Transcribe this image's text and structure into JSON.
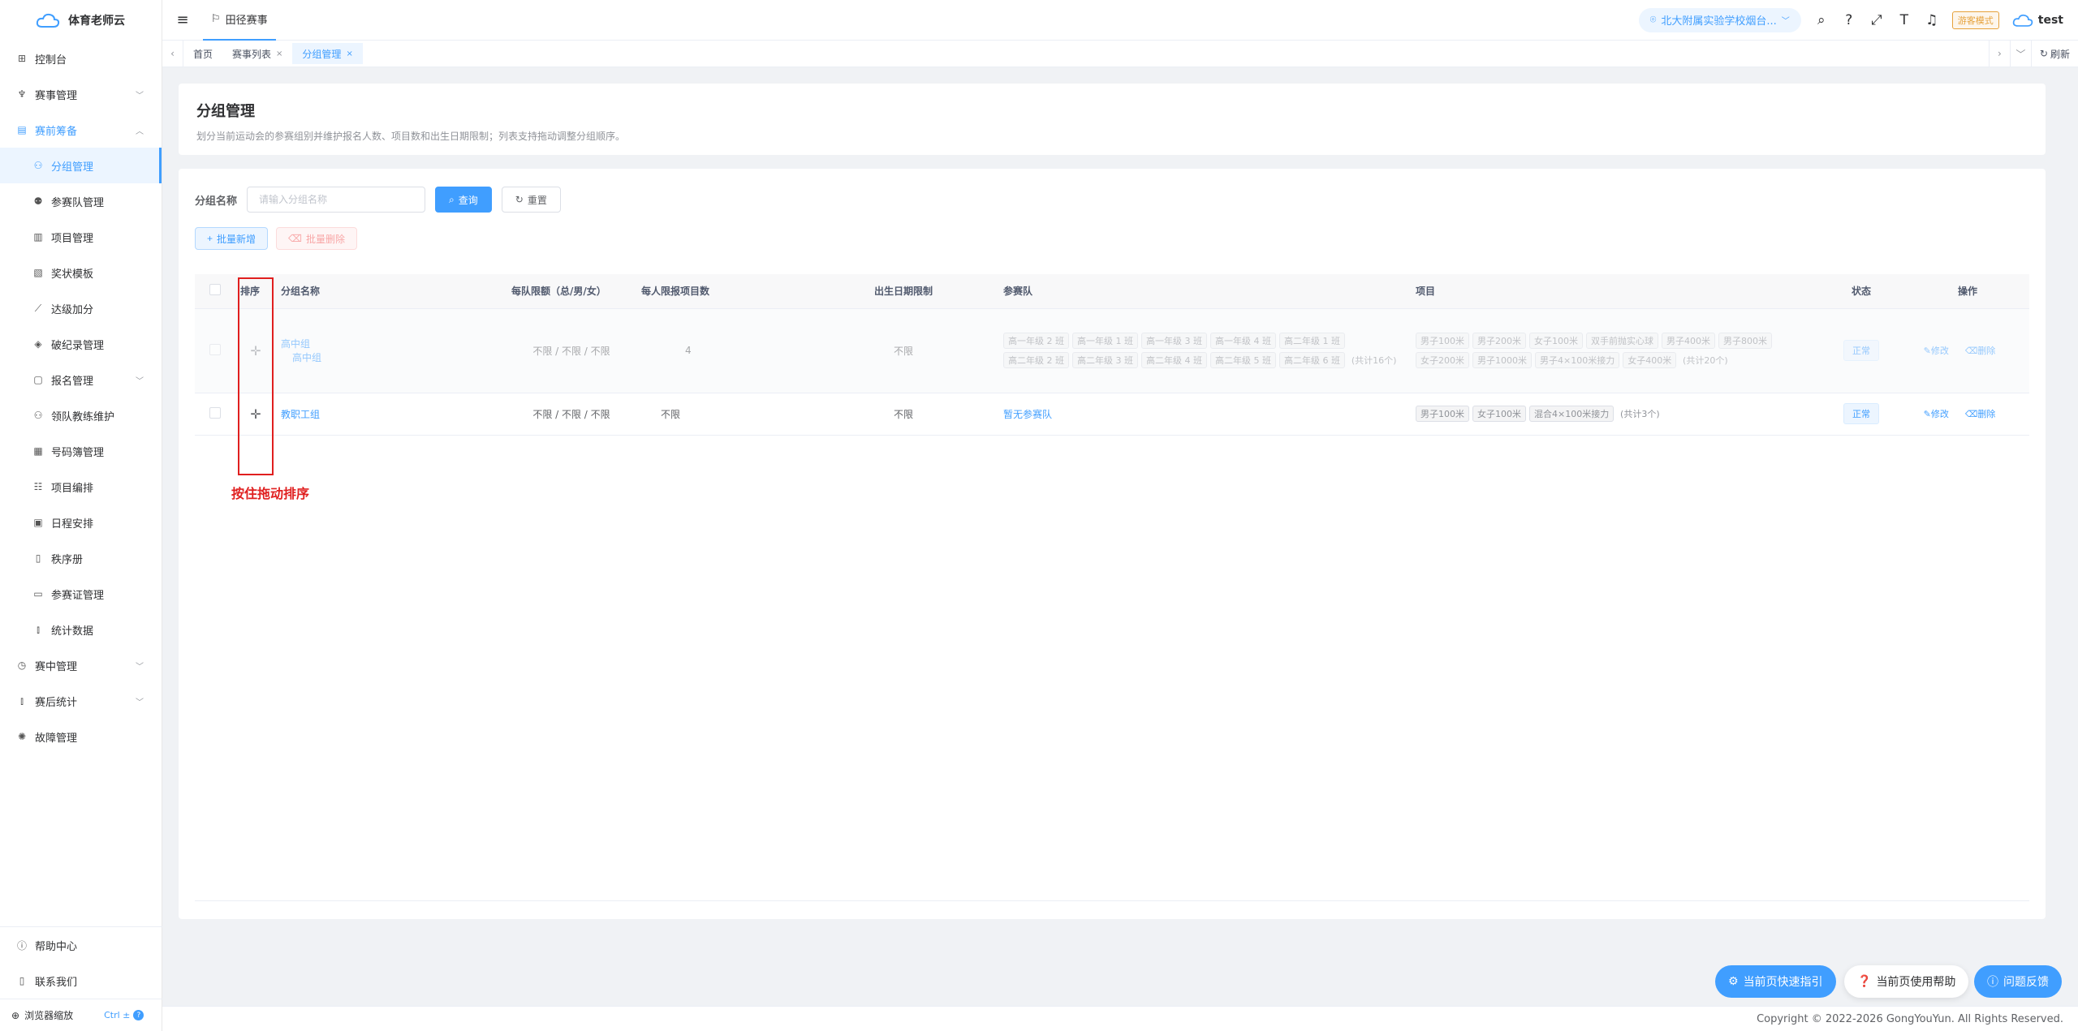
{
  "app": {
    "name": "体育老师云"
  },
  "sidebar": {
    "items": [
      {
        "label": "控制台",
        "icon": "dashboard-icon"
      },
      {
        "label": "赛事管理",
        "icon": "trophy-icon",
        "chevron": "﹀"
      },
      {
        "label": "赛前筹备",
        "icon": "clipboard-icon",
        "chevron": "︿"
      },
      {
        "label": "分组管理",
        "icon": "group-icon"
      },
      {
        "label": "参赛队管理",
        "icon": "team-icon"
      },
      {
        "label": "项目管理",
        "icon": "document-icon"
      },
      {
        "label": "奖状模板",
        "icon": "certificate-icon"
      },
      {
        "label": "达级加分",
        "icon": "chart-icon"
      },
      {
        "label": "破纪录管理",
        "icon": "record-icon"
      },
      {
        "label": "报名管理",
        "icon": "signup-icon",
        "chevron": "﹀"
      },
      {
        "label": "领队教练维护",
        "icon": "coach-icon"
      },
      {
        "label": "号码簿管理",
        "icon": "bib-icon"
      },
      {
        "label": "项目编排",
        "icon": "schedule-icon"
      },
      {
        "label": "日程安排",
        "icon": "calendar-icon"
      },
      {
        "label": "秩序册",
        "icon": "book-icon"
      },
      {
        "label": "参赛证管理",
        "icon": "pass-icon"
      },
      {
        "label": "统计数据",
        "icon": "stats-icon"
      },
      {
        "label": "赛中管理",
        "icon": "timer-icon",
        "chevron": "﹀"
      },
      {
        "label": "赛后统计",
        "icon": "bar-icon",
        "chevron": "﹀"
      },
      {
        "label": "故障管理",
        "icon": "bug-icon"
      }
    ],
    "bottom": {
      "help": "帮助中心",
      "contact": "联系我们",
      "zoom": "浏览器缩放",
      "zoom_kbd": "Ctrl ±",
      "zoom_q": "?"
    }
  },
  "header": {
    "tab": "田径赛事",
    "school": "北大附属实验学校烟台...",
    "guest_mode": "游客模式",
    "user": "test"
  },
  "tags": {
    "items": [
      {
        "label": "首页",
        "close": ""
      },
      {
        "label": "赛事列表",
        "close": "×"
      },
      {
        "label": "分组管理",
        "close": "×"
      }
    ],
    "refresh": "刷新"
  },
  "page": {
    "title": "分组管理",
    "desc": "划分当前运动会的参赛组别并维护报名人数、项目数和出生日期限制；列表支持拖动调整分组顺序。"
  },
  "search": {
    "label": "分组名称",
    "placeholder": "请输入分组名称",
    "query": "查询",
    "reset": "重置"
  },
  "toolbar": {
    "batch_add": "批量新增",
    "batch_delete": "批量删除"
  },
  "table": {
    "headers": [
      "排序",
      "分组名称",
      "每队限额（总/男/女）",
      "每人限报项目数",
      "出生日期限制",
      "参赛队",
      "项目",
      "状态",
      "操作"
    ],
    "rows": [
      {
        "name": "高中组",
        "name_ghost": "高中组",
        "quota": "不限 / 不限 / 不限",
        "per_person": "4",
        "birth": "不限",
        "teams": [
          "高一年级 2 班",
          "高一年级 1 班",
          "高一年级 3 班",
          "高一年级 4 班",
          "高二年级 1 班",
          "高二年级 2 班",
          "高二年级 3 班",
          "高二年级 4 班",
          "高二年级 5 班",
          "高二年级 6 班"
        ],
        "teams_count": "(共计16个)",
        "events": [
          "男子100米",
          "男子200米",
          "女子100米",
          "双手前抛实心球",
          "男子400米",
          "男子800米",
          "女子200米",
          "男子1000米",
          "男子4×100米接力",
          "女子400米"
        ],
        "events_count": "(共计20个)",
        "status": "正常",
        "edit": "修改",
        "del": "删除"
      },
      {
        "name": "教职工组",
        "quota": "不限 / 不限 / 不限",
        "per_person": "不限",
        "birth": "不限",
        "teams_empty": "暂无参赛队",
        "events": [
          "男子100米",
          "女子100米",
          "混合4×100米接力"
        ],
        "events_count": "(共计3个)",
        "status": "正常",
        "edit": "修改",
        "del": "删除"
      }
    ]
  },
  "annotation": {
    "drag_hint": "按住拖动排序"
  },
  "fabs": {
    "guide": "当前页快速指引",
    "help": "当前页使用帮助",
    "feedback": "问题反馈"
  },
  "footer": {
    "copyright": "Copyright © 2022-2026 GongYouYun. All Rights Reserved."
  }
}
